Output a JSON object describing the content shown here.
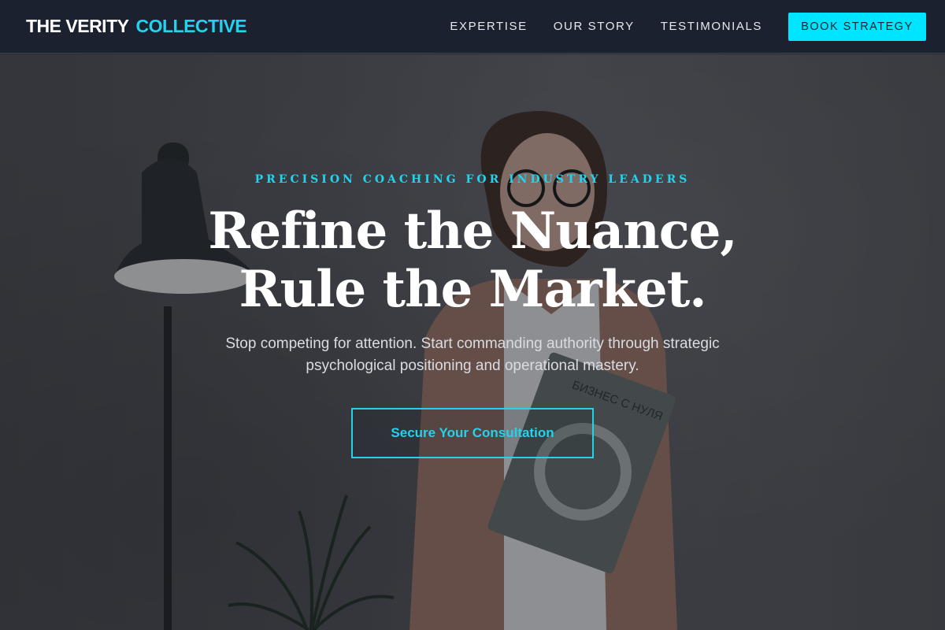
{
  "brand": {
    "word1": "THE VERITY",
    "word2": "COLLECTIVE"
  },
  "nav": {
    "links": [
      "EXPERTISE",
      "OUR STORY",
      "TESTIMONIALS"
    ],
    "cta": "BOOK STRATEGY"
  },
  "hero": {
    "eyebrow": "PRECISION COACHING FOR INDUSTRY LEADERS",
    "headline_line1": "Refine the Nuance,",
    "headline_line2": "Rule the Market.",
    "subtitle": "Stop competing for attention. Start commanding authority through strategic psychological positioning and operational mastery.",
    "button": "Secure Your Consultation",
    "book_text": "БИЗНЕС С НУЛЯ"
  },
  "colors": {
    "accent": "#22d3ee",
    "nav_bg": "#1c2130",
    "cta_bg": "#00e5ff"
  }
}
